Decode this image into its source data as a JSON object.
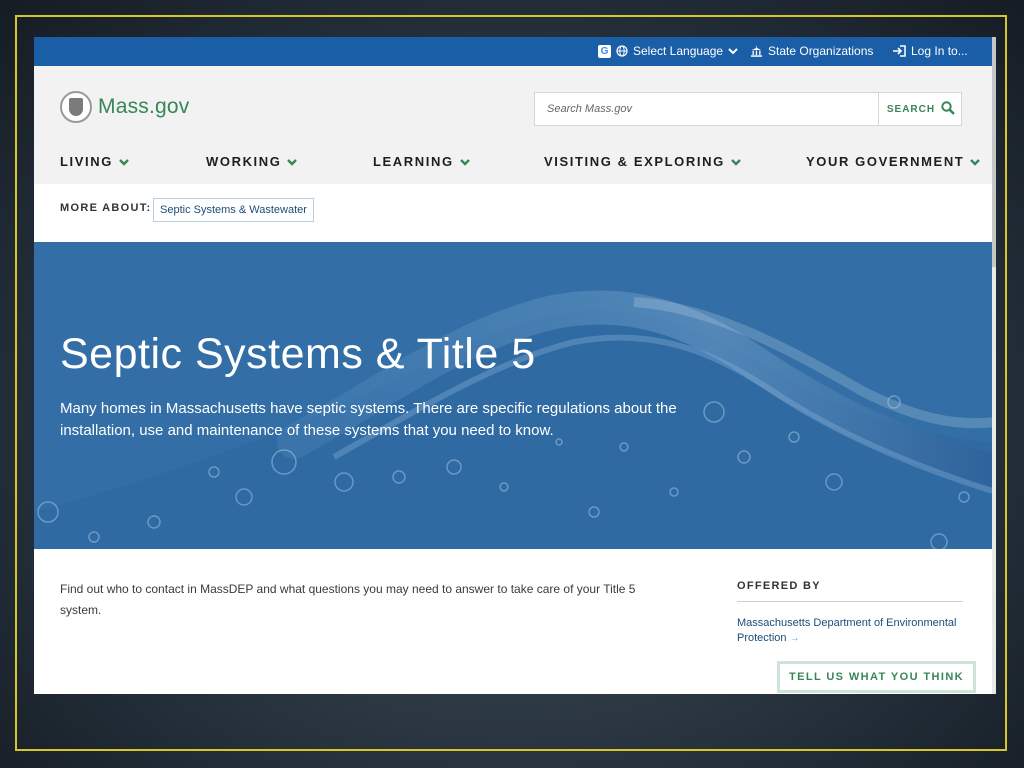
{
  "utility_bar": {
    "google_icon_letter": "G",
    "select_language": "Select Language",
    "state_organizations": "State Organizations",
    "log_in": "Log In to..."
  },
  "header": {
    "logo_text": "Mass.gov",
    "search": {
      "placeholder": "Search Mass.gov",
      "button_label": "SEARCH"
    },
    "nav": [
      "LIVING",
      "WORKING",
      "LEARNING",
      "VISITING & EXPLORING",
      "YOUR GOVERNMENT"
    ]
  },
  "more_about": {
    "label": "MORE ABOUT:",
    "link": "Septic Systems & Wastewater"
  },
  "hero": {
    "title": "Septic Systems & Title 5",
    "description": "Many homes in Massachusetts have septic systems. There are specific regulations about the installation, use and maintenance of these systems that you need to know."
  },
  "content": {
    "intro": "Find out who to contact in MassDEP and what questions you may need to answer to take care of your Title 5 system."
  },
  "offered_by": {
    "label": "OFFERED BY",
    "organization": "Massachusetts Department of Environmental Protection",
    "arrow": "→"
  },
  "feedback_button": "TELL US WHAT YOU THINK",
  "colors": {
    "utility_bar": "#1a5ea8",
    "brand_green": "#388557",
    "hero_blue": "#336fa6",
    "link_blue": "#1a4e7a",
    "slide_border": "#d8c629"
  }
}
